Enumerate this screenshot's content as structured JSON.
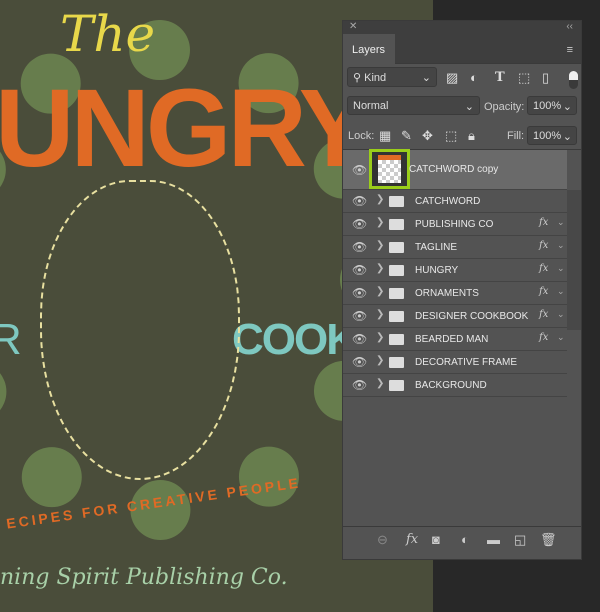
{
  "artwork": {
    "the": "The",
    "hungry": "UNGRY",
    "cookbook": "COOKBO",
    "left_letter": "R",
    "tagline": "ECIPES FOR CREATIVE PEOPLE",
    "publisher": "ning Spirit Publishing Co."
  },
  "panel": {
    "close": "✕",
    "collapse": "‹‹",
    "tab": "Layers",
    "menu": "≡"
  },
  "filter": {
    "kind": "Kind"
  },
  "blend": {
    "mode": "Normal",
    "opacity_label": "Opacity:",
    "opacity": "100%"
  },
  "lock": {
    "label": "Lock:",
    "fill_label": "Fill:",
    "fill": "100%"
  },
  "layers": [
    {
      "name": "CATCHWORD copy",
      "selected": true
    },
    {
      "name": "CATCHWORD",
      "fx": false
    },
    {
      "name": "PUBLISHING CO",
      "fx": true
    },
    {
      "name": "TAGLINE",
      "fx": true
    },
    {
      "name": "HUNGRY",
      "fx": true
    },
    {
      "name": "ORNAMENTS",
      "fx": true
    },
    {
      "name": "DESIGNER COOKBOOK",
      "fx": true
    },
    {
      "name": "BEARDED MAN",
      "fx": true
    },
    {
      "name": "DECORATIVE FRAME",
      "fx": false
    },
    {
      "name": "BACKGROUND",
      "fx": false
    }
  ],
  "fx_label": "fx",
  "colors": {
    "selection_highlight": "#9acd1a",
    "canvas": "#4a4d3a",
    "panel": "#535353"
  }
}
